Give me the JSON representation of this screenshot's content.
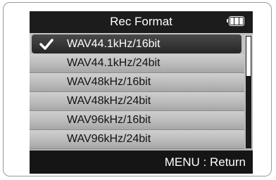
{
  "header": {
    "title": "Rec Format",
    "battery_icon": "battery-full-icon",
    "battery_level": 1.0
  },
  "menu": {
    "items": [
      {
        "label": "WAV44.1kHz/16bit",
        "selected": true
      },
      {
        "label": "WAV44.1kHz/24bit",
        "selected": false
      },
      {
        "label": "WAV48kHz/16bit",
        "selected": false
      },
      {
        "label": "WAV48kHz/24bit",
        "selected": false
      },
      {
        "label": "WAV96kHz/16bit",
        "selected": false
      },
      {
        "label": "WAV96kHz/24bit",
        "selected": false
      }
    ],
    "check_icon": "checkmark-icon"
  },
  "scrollbar": {
    "position": 0.0,
    "visible_fraction": 0.35
  },
  "footer": {
    "hint": "MENU : Return"
  },
  "colors": {
    "screen_bg": "#1a1a1a",
    "list_bg": "#bdbdbd",
    "selected_bg": "#2e2e2e",
    "text_light": "#ffffff",
    "text_dark": "#111111"
  }
}
